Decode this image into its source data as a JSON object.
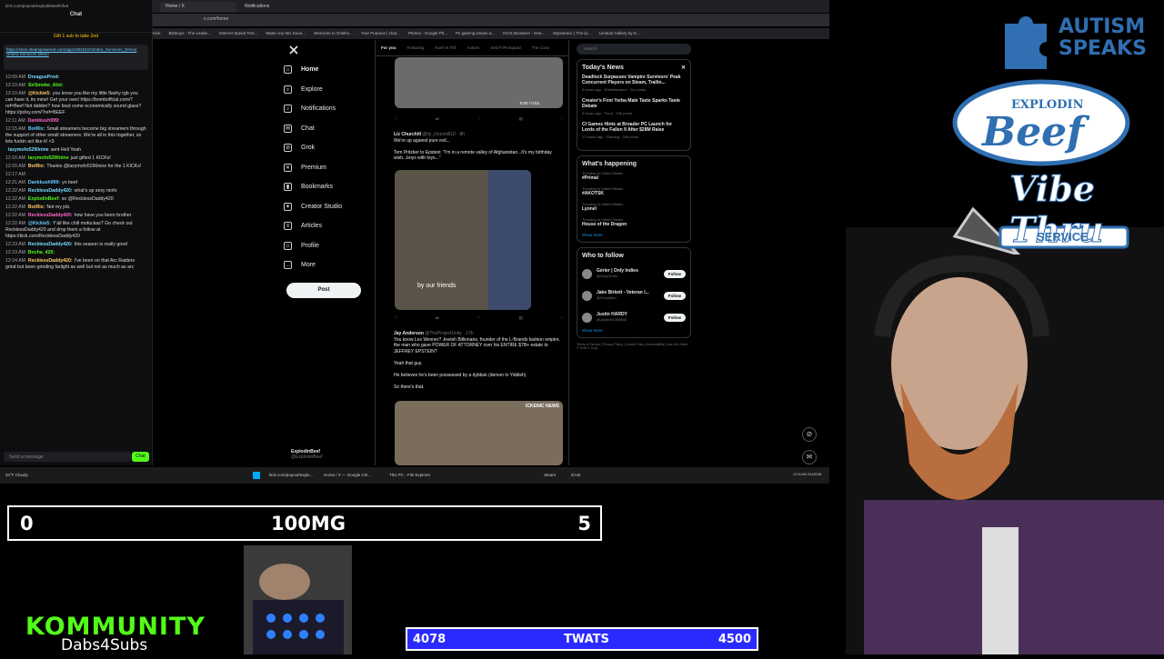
{
  "chrome": {
    "tabs": [
      "Home / X",
      "Notifications"
    ],
    "url": "x.com/home",
    "chat_url": "kick.com/popout/explodinbeef/chat",
    "bookmarks": [
      "Kick",
      "Bitsbuys - The Leade...",
      "Internet Speed Test...",
      "Make Any Mix Soun...",
      "Welcome to Ooleko...",
      "Your Purpose | chat...",
      "Photos - Google Ph...",
      "Ps gaming issues w...",
      "KICK Boosters - reve...",
      "Mytestonic | The la...",
      "Limitool Gallery by K..."
    ]
  },
  "chat": {
    "title": "Chat",
    "banner": "Gift 1 sub to take 2nd",
    "pinned_link": "https://store.steampowered.com/app/4391810/Umbra_Survivors_Demo/ Umbra Survivors Demo",
    "messages": [
      {
        "time": "12:09 AM",
        "user": "DreagusProd:",
        "text": ""
      },
      {
        "time": "12:10 AM",
        "user": "SirSmoke_Alot:",
        "text": ""
      },
      {
        "time": "12:10 AM",
        "user": "@Kickie5:",
        "text": "you know you like my little flashy rgb you can have it, its mine! Get your own! https://bomboffcial.com/?ref=Beef Not dabbin? how bout some economically sound glass? https://polvy.com/?ref=BEEF"
      },
      {
        "time": "12:11 AM",
        "user": "Dankkush999:",
        "text": ""
      },
      {
        "time": "12:15 AM",
        "user": "BotRix:",
        "text": "Small streamers become big streamers through the support of other small streamers. We're all in this together, so lets fuckin act like it! <3"
      },
      {
        "time": "",
        "user": "lazymofo5290nine",
        "text": "sent Hell Yeah"
      },
      {
        "time": "12:16 AM",
        "user": "lazymofo5290nine",
        "text": "just gifted 1 KICKs!"
      },
      {
        "time": "12:16 AM",
        "user": "BotRix:",
        "text": "Thanks @lazymofo5290nine for the 1 KICKs!"
      },
      {
        "time": "12:17 AM",
        "user": "",
        "text": ""
      },
      {
        "time": "12:21 AM",
        "user": "Dankkush999:",
        "text": "yo beef"
      },
      {
        "time": "12:22 AM",
        "user": "RecklessDaddy420:",
        "text": "what's up sexy mofo"
      },
      {
        "time": "12:22 AM",
        "user": "ExplodinBeef:",
        "text": "so @RecklessDaddy420"
      },
      {
        "time": "12:22 AM",
        "user": "BotRix:",
        "text": "Not my job."
      },
      {
        "time": "12:22 AM",
        "user": "RecklessDaddy420:",
        "text": "how have you been brother"
      },
      {
        "time": "12:22 AM",
        "user": "@Kickie5:",
        "text": "Y'all like chill mofuckas? Go check out RecklessDaddy420 and drop them a follow at https://kick.com/RecklessDaddy420"
      },
      {
        "time": "12:23 AM",
        "user": "RecklessDaddy420:",
        "text": "this season is really good"
      },
      {
        "time": "12:23 AM",
        "user": "Bocha_420:",
        "text": ""
      },
      {
        "time": "12:24 AM",
        "user": "RecklessDaddy420:",
        "text": "I've been on that Arc Raiders grind but been grinding farlight as well but not as much as arc"
      }
    ],
    "input_placeholder": "Send a message",
    "send_label": "Chat"
  },
  "nav": {
    "items": [
      "Home",
      "Explore",
      "Notifications",
      "Chat",
      "Grok",
      "Premium",
      "Bookmarks",
      "Creator Studio",
      "Articles",
      "Profile",
      "More"
    ],
    "post_label": "Post",
    "profile_name": "ExplodinBeef",
    "profile_handle": "@ExplodinBeef"
  },
  "feed": {
    "tabs": [
      "For you",
      "Following",
      "Kush N Trill",
      "Autism",
      "XeloTVPoSquad",
      "The Conn"
    ],
    "video_time": "0:00 / 0:53",
    "tweet1": {
      "name": "Liz Churchill",
      "handle": "@liz_churchill10 · 8h",
      "line1": "We're up against pure evil...",
      "line2": "Tom Pritzker to Epstein: \"I'm in a remote valley of Afghanistan...It's my birthday wish...boys with toys...\"",
      "caption": "by our friends"
    },
    "tweet2": {
      "name": "Jay Anderson",
      "handle": "@TheProjectUnity · 17h",
      "text": "You know Les Wexner? Jewish Billionaire, founder of the L-Brands fashion empire, the man who gave POWER OF ATTORNEY over his ENTIRE $7B+ estate to JEFFREY EPSTEIN?",
      "text2": "Yeah that guy.",
      "text3": "He believes he's been possessed by a dybbuk (demon in Yiddish)",
      "text4": "So there's that.",
      "media_label": "ICKENIC NEWS"
    }
  },
  "sidebar": {
    "search_placeholder": "Search",
    "news_title": "Today's News",
    "news": [
      {
        "title": "Deadlock Surpasses Vampire Survivors' Peak Concurrent Players on Steam, Trailin...",
        "meta": "5 hours ago · Entertainment · 2xx posts"
      },
      {
        "title": "Creator's First Yerba Mate Taste Sparks Taste Debate",
        "meta": "5 hours ago · Food · 345 posts"
      },
      {
        "title": "CI Games Hints at Broader PC Launch for Lords of the Fallen II After $28M Raise",
        "meta": "17 hours ago · Gaming · 345 posts"
      }
    ],
    "happening_title": "What's happening",
    "trends": [
      {
        "meta": "Trending in United States",
        "name": "#Primal"
      },
      {
        "meta": "Trending in United States",
        "name": "#AKOTSK"
      },
      {
        "meta": "Trending in United States",
        "name": "Lyonel"
      },
      {
        "meta": "Trending in United States",
        "name": "House of the Dragon"
      }
    ],
    "show_more": "Show more",
    "follow_title": "Who to follow",
    "follow": [
      {
        "name": "Gérier | Only Indies",
        "handle": "@OnlyGerier"
      },
      {
        "name": "Jake Birkett - Veteran I...",
        "handle": "@GreyAlien"
      },
      {
        "name": "Justin HARDY",
        "handle": "@JustinH1395865"
      }
    ],
    "follow_label": "Follow",
    "footer": "Terms of Service | Privacy Policy | Cookie Policy | Accessibility | Ads info | More · © 2026 X Corp."
  },
  "taskbar": {
    "weather": "34°F Cloudy",
    "items": [
      "kick.com/popout/explo...",
      "Home / X — Google Chr...",
      "This PC - File Explorer",
      "Steam",
      "iCUE"
    ],
    "clock": "12:24 AM 2/14/2026"
  },
  "overlay": {
    "autism_speaks": "AUTISM SPEAKS",
    "beef_line1": "EXPLODIN",
    "beef_line2": "Beef",
    "beef_line3": "Vibe Thru",
    "beef_line4": "SERVICE",
    "counter_left": "0",
    "counter_center": "100MG",
    "counter_right": "5",
    "kommunity": "KOMMUNITY",
    "dabs": "Dabs4Subs",
    "goal_left": "4078",
    "goal_center": "TWATS",
    "goal_right": "4500",
    "colors": {
      "kick_green": "#53fc18",
      "goal_blue": "#2a2aff",
      "x_blue": "#1d9bf0"
    }
  }
}
